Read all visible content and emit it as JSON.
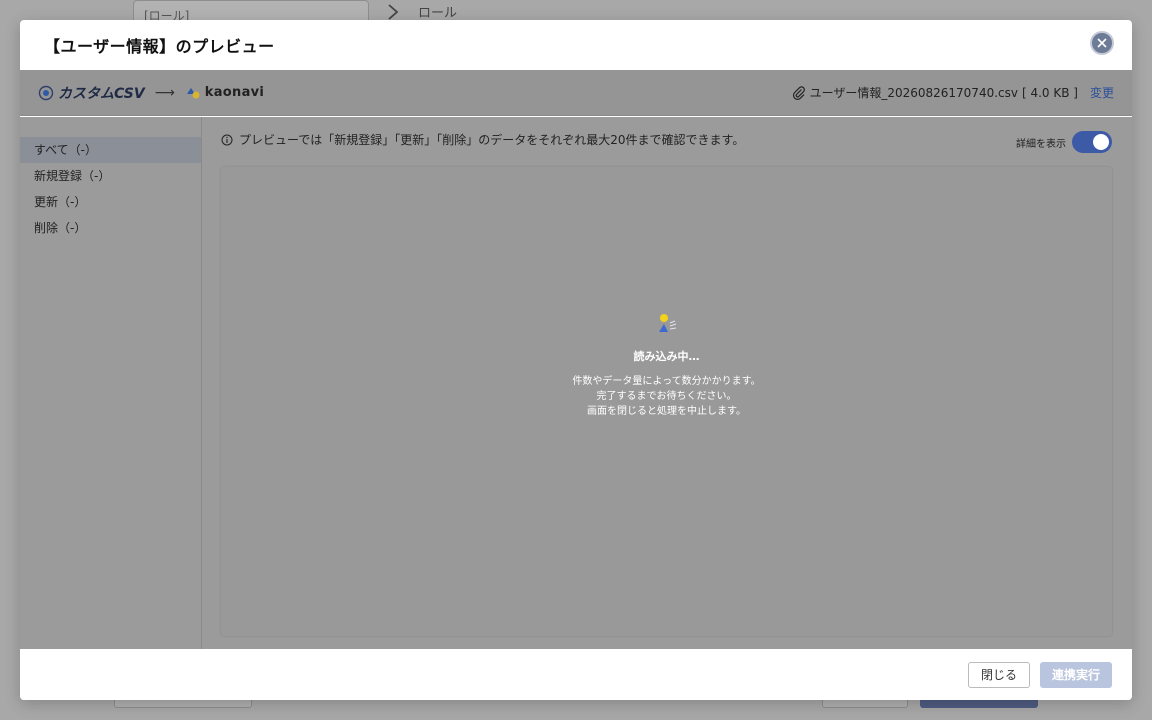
{
  "background": {
    "select_value": "[ロール]",
    "breadcrumb_role": "ロール"
  },
  "modal": {
    "title": "【ユーザー情報】のプレビュー",
    "source_label": "カスタムCSV",
    "arrow": "⟶",
    "destination_label": "kaonavi",
    "file_name": "ユーザー情報_20260826170740.csv",
    "file_size": "[ 4.0 KB ]",
    "change_label": "変更"
  },
  "sidebar": {
    "items": [
      {
        "label": "すべて（-）"
      },
      {
        "label": "新規登録（-）"
      },
      {
        "label": "更新（-）"
      },
      {
        "label": "削除（-）"
      }
    ]
  },
  "main": {
    "info_text": "プレビューでは「新規登録」「更新」「削除」のデータをそれぞれ最大20件まで確認できます。",
    "toggle_label": "詳細を表示",
    "toggle_on": true
  },
  "loading": {
    "title": "読み込み中…",
    "line1": "件数やデータ量によって数分かかります。",
    "line2": "完了するまでお待ちください。",
    "line3": "画面を閉じると処理を中止します。"
  },
  "footer": {
    "close_label": "閉じる",
    "run_label": "連携実行"
  },
  "colors": {
    "accent": "#3d5aa6",
    "run_disabled": "#b9c4de",
    "link": "#2b4f9a"
  }
}
